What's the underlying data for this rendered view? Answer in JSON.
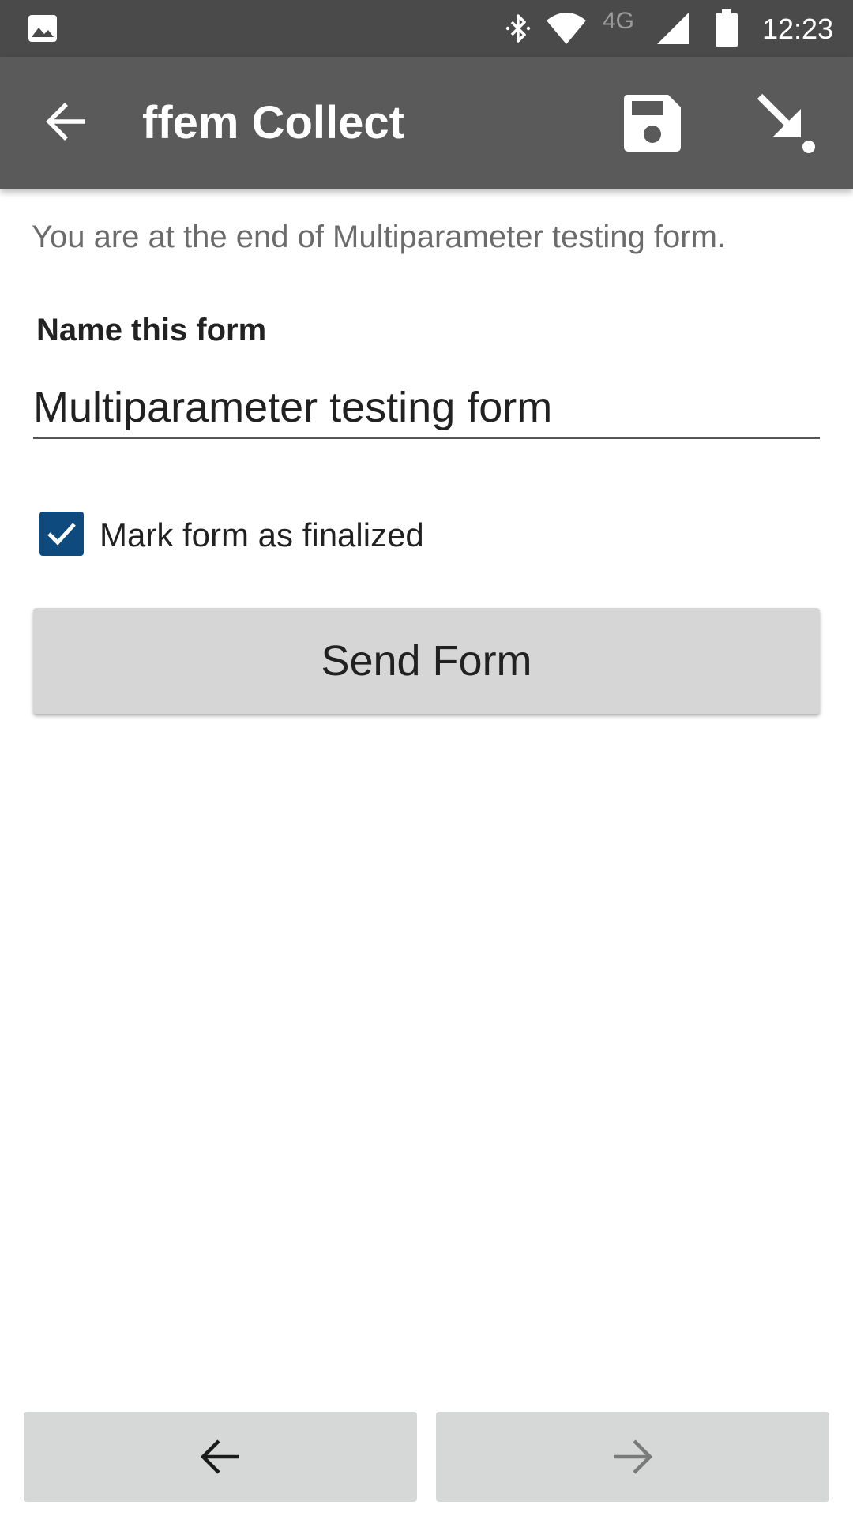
{
  "status_bar": {
    "network_type": "4G",
    "time": "12:23",
    "icons": [
      "gallery-icon",
      "bluetooth-icon",
      "wifi-icon",
      "signal-icon",
      "battery-icon"
    ]
  },
  "app_bar": {
    "title": "ffem Collect",
    "icons": [
      "back-arrow-icon",
      "save-icon",
      "jump-icon"
    ]
  },
  "form_end": {
    "message": "You are at the end of Multiparameter testing form.",
    "name_label": "Name this form",
    "name_value": "Multiparameter testing form",
    "finalize_label": "Mark form as finalized",
    "finalize_checked": true,
    "send_button": "Send Form"
  },
  "bottom_nav": {
    "icons": [
      "arrow-left-icon",
      "arrow-right-icon"
    ]
  },
  "colors": {
    "status_bar": "#4a4a4a",
    "app_bar": "#5a5a5a",
    "checkbox": "#0f4a7e",
    "button": "#d6d6d6"
  }
}
